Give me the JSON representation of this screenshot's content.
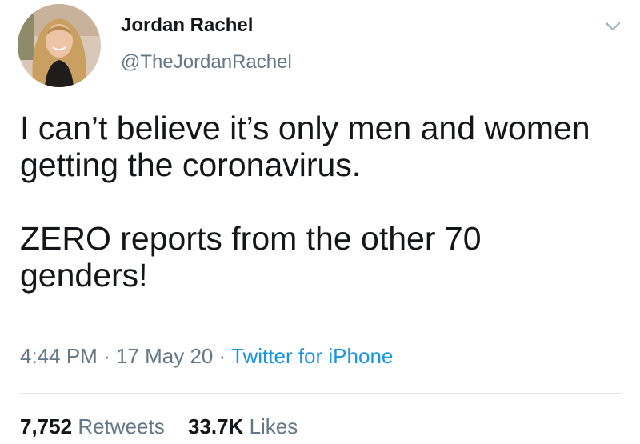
{
  "tweet": {
    "author": {
      "display_name": "Jordan Rachel",
      "handle": "@TheJordanRachel"
    },
    "text_paragraphs": [
      "I can’t believe it’s only men and women getting the coronavirus.",
      "ZERO reports from the other 70 genders!"
    ],
    "time": "4:44 PM",
    "date": "17 May 20",
    "separator": "·",
    "source": "Twitter for iPhone",
    "stats": {
      "retweets_count": "7,752",
      "retweets_label": "Retweets",
      "likes_count": "33.7K",
      "likes_label": "Likes"
    }
  },
  "colors": {
    "text_primary": "#14171a",
    "text_secondary": "#657786",
    "link": "#1b95e0",
    "divider": "#e1e8ed",
    "chevron": "#aab8c2"
  },
  "icons": {
    "avatar": "profile-photo",
    "menu": "chevron-down-icon"
  }
}
